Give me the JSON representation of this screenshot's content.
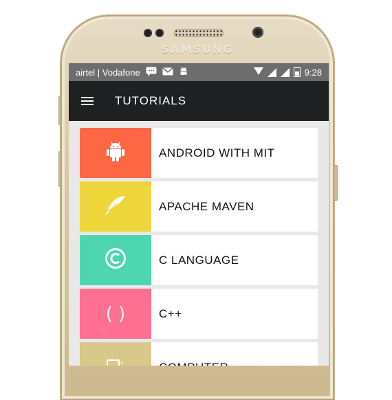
{
  "device": {
    "brand": "SAMSUNG"
  },
  "status_bar": {
    "carrier": "airtel | Vodafone",
    "time": "9:28",
    "icons": [
      "message-icon",
      "mail-icon",
      "android-icon",
      "wifi-icon",
      "signal-icon",
      "signal-icon",
      "battery-icon"
    ]
  },
  "toolbar": {
    "menu_icon": "hamburger-icon",
    "title": "TUTORIALS"
  },
  "tutorials": [
    {
      "label": "ANDROID WITH MIT",
      "color": "#ff6644",
      "icon": "android-icon"
    },
    {
      "label": "APACHE MAVEN",
      "color": "#eed63a",
      "icon": "feather-icon"
    },
    {
      "label": "C LANGUAGE",
      "color": "#4dd6b0",
      "icon": "copyright-icon"
    },
    {
      "label": "C++",
      "color": "#ff6f91",
      "icon": "parentheses-icon",
      "glyph": "( )"
    },
    {
      "label": "COMPUTER",
      "color": "#d8c98b",
      "icon": "computer-icon"
    }
  ]
}
